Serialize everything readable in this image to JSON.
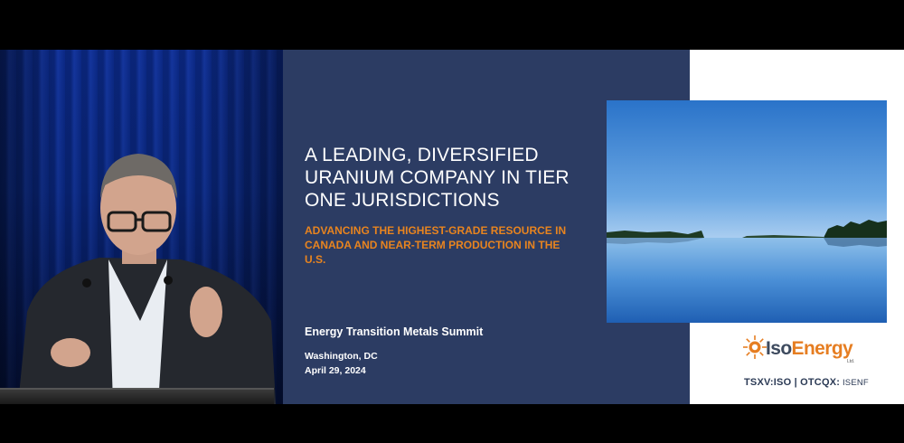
{
  "slide": {
    "title": "A LEADING, DIVERSIFIED URANIUM COMPANY IN TIER ONE JURISDICTIONS",
    "subtitle": "ADVANCING THE HIGHEST-GRADE RESOURCE IN CANADA AND NEAR-TERM PRODUCTION IN THE U.S.",
    "event_name": "Energy Transition Metals Summit",
    "location": "Washington, DC",
    "date": "April 29, 2024",
    "logo": {
      "part1": "Iso",
      "part2": "Energy",
      "suffix": "Ltd."
    },
    "ticker_main": "TSXV:ISO | OTCQX:",
    "ticker_otc": " ISENF"
  },
  "colors": {
    "slide_panel": "#2c3c63",
    "accent_orange": "#e8841f",
    "curtain_blue": "#0a2a8a"
  }
}
